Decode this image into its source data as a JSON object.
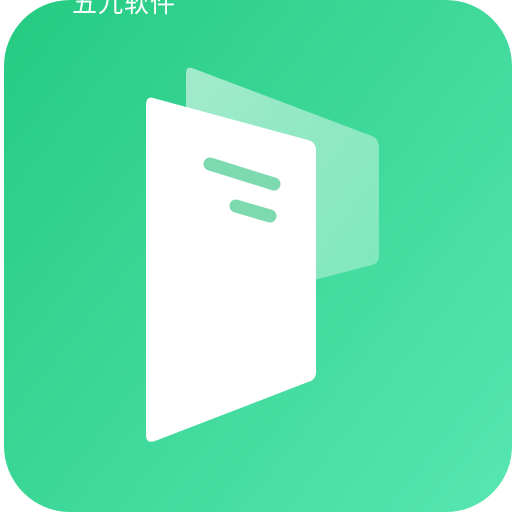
{
  "app_icon": {
    "caption": "五九软件",
    "icon_name": "document-sheets-icon",
    "colors": {
      "gradient_start": "#27CC83",
      "gradient_end": "#55E5B0",
      "front_sheet": "#FFFFFF",
      "back_sheet_overlay": "#D8F5E8",
      "text_lines": "#7DD9AE"
    }
  }
}
